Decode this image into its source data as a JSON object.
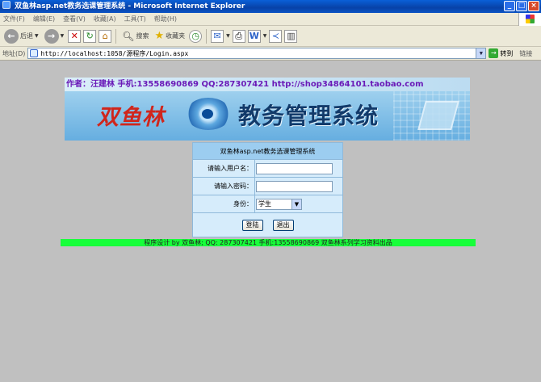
{
  "window": {
    "title": "双鱼林asp.net教务选课管理系统 - Microsoft Internet Explorer",
    "controls": [
      "_",
      "□",
      "×"
    ]
  },
  "menu": [
    "文件(F)",
    "编辑(E)",
    "查看(V)",
    "收藏(A)",
    "工具(T)",
    "帮助(H)"
  ],
  "toolbar": {
    "back": "后退",
    "search": "搜索",
    "favorites": "收藏夹"
  },
  "address": {
    "label": "地址(D)",
    "url": "http://localhost:1058/源程序/Login.aspx",
    "go": "转到",
    "links": "链接"
  },
  "banner": {
    "author_line": "作者：汪建林  手机:13558690869  QQ:287307421  http://shop34864101.taobao.com",
    "brand": "双鱼林",
    "system_title": "教务管理系统"
  },
  "login": {
    "heading": "双鱼林asp.net教务选课管理系统",
    "username_label": "请输入用户名：",
    "username_value": "",
    "password_label": "请输入密码：",
    "password_value": "",
    "role_label": "身份：",
    "role_value": "学生",
    "login_button": "登陆",
    "exit_button": "退出"
  },
  "footer": {
    "text": "程序设计 by 双鱼林; QQ: 287307421 手机:13558690869 双鱼林系列学习资料出品"
  },
  "colors": {
    "footer_bg": "#17ff3a",
    "panel_row_bg": "#d6ecfb",
    "panel_head_bg": "#9ccdf0",
    "page_bg": "#c0c0c0"
  }
}
